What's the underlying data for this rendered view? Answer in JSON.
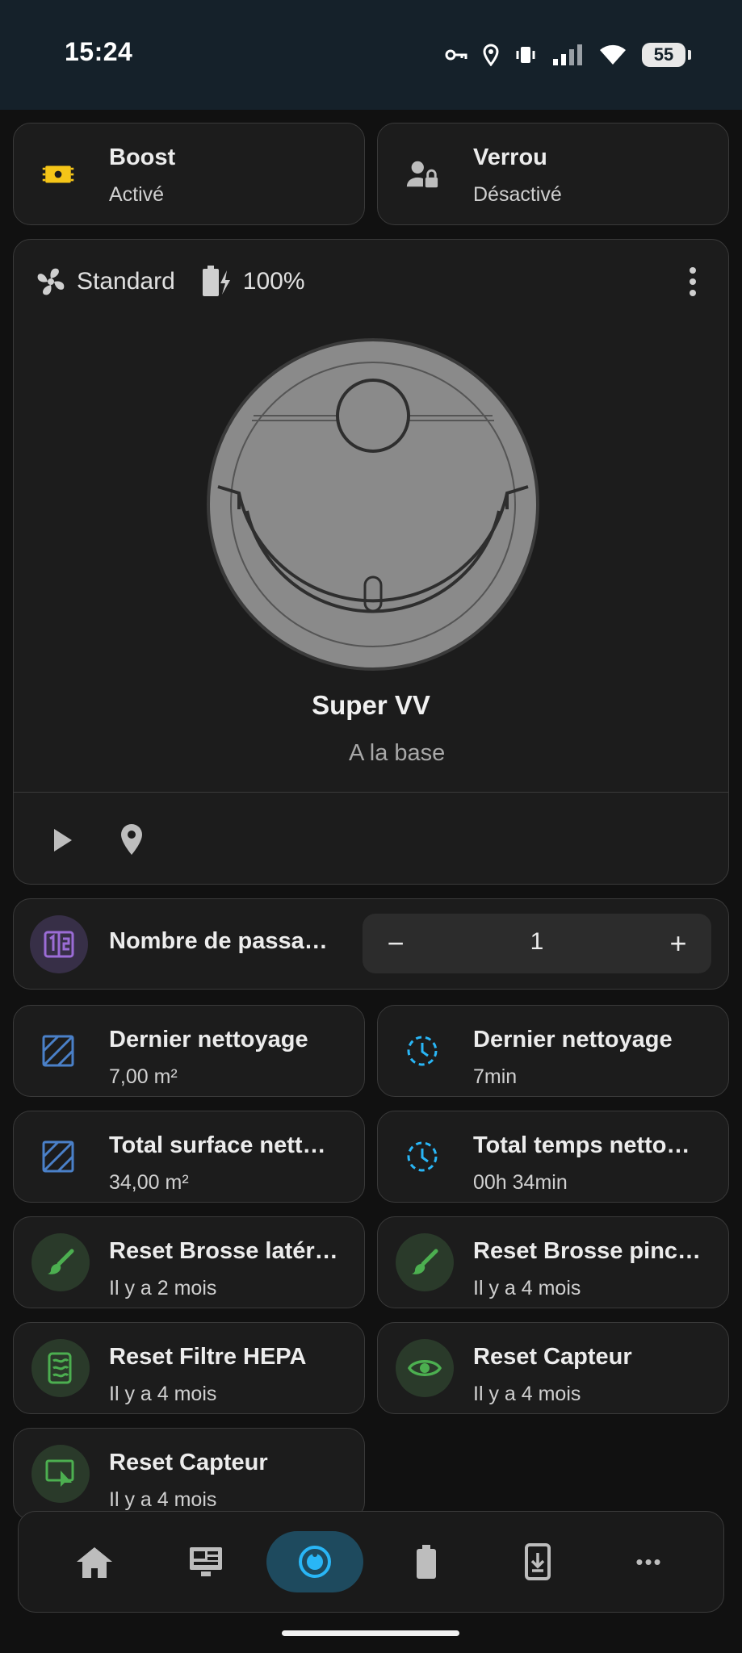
{
  "status_bar": {
    "time": "15:24",
    "battery": "55"
  },
  "tiles_top": [
    {
      "title": "Boost",
      "state": "Activé"
    },
    {
      "title": "Verrou",
      "state": "Désactivé"
    }
  ],
  "vacuum": {
    "fan_mode": "Standard",
    "battery": "100%",
    "name": "Super VV",
    "status": "A la base"
  },
  "passes": {
    "label": "Nombre de passa…",
    "value": "1",
    "minus": "−",
    "plus": "+"
  },
  "sensors": [
    {
      "title": "Dernier nettoyage",
      "value": "7,00 m²"
    },
    {
      "title": "Dernier nettoyage",
      "value": "7min"
    },
    {
      "title": "Total surface nett…",
      "value": "34,00 m²"
    },
    {
      "title": "Total temps netto…",
      "value": "00h 34min"
    },
    {
      "title": "Reset Brosse latér…",
      "value": "Il y a 2 mois"
    },
    {
      "title": "Reset Brosse pinc…",
      "value": "Il y a 4 mois"
    },
    {
      "title": "Reset Filtre HEPA",
      "value": "Il y a 4 mois"
    },
    {
      "title": "Reset Capteur",
      "value": "Il y a 4 mois"
    },
    {
      "title": "Reset Capteur",
      "value": "Il y a 4 mois"
    }
  ],
  "nav": {
    "items": [
      "home-icon",
      "dashboard-icon",
      "vacuum-icon",
      "battery-icon",
      "phone-download-icon",
      "more-icon"
    ],
    "more_label": "•••"
  },
  "colors": {
    "accent_blue": "#29b6f6",
    "area_blue": "#4a80c8",
    "green": "#4caf50",
    "purple": "#9b6cd6",
    "yellow": "#f5c518",
    "active_nav": "#1e4a5e"
  }
}
